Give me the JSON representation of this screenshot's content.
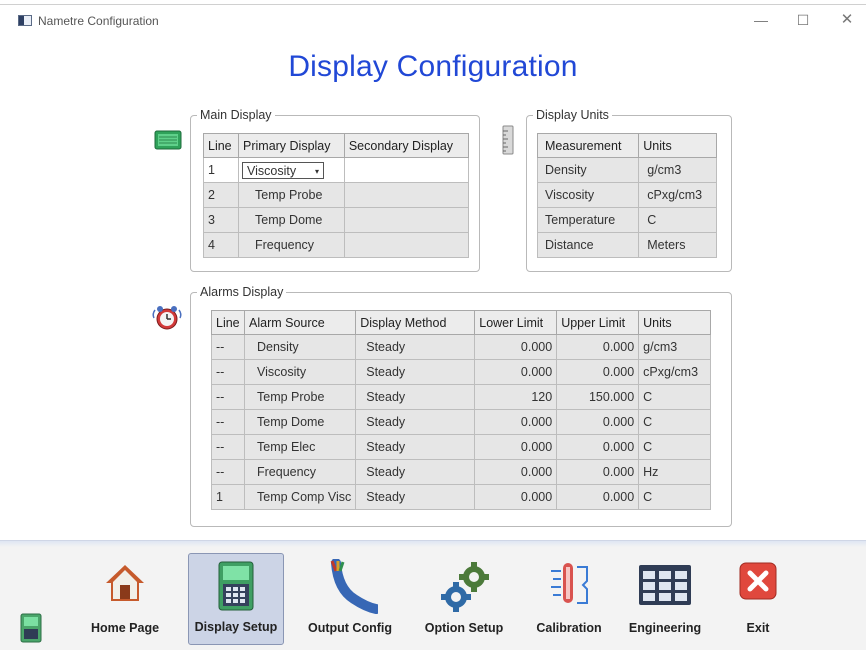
{
  "window": {
    "title": "Nametre Configuration",
    "minimize": "—",
    "maximize": "☐",
    "close": "✕"
  },
  "page_title": "Display Configuration",
  "main_display": {
    "label": "Main Display",
    "headers": [
      "Line",
      "Primary Display",
      "Secondary Display"
    ],
    "rows": [
      {
        "line": "1",
        "primary": "Viscosity",
        "secondary": ""
      },
      {
        "line": "2",
        "primary": "Temp Probe",
        "secondary": ""
      },
      {
        "line": "3",
        "primary": "Temp Dome",
        "secondary": ""
      },
      {
        "line": "4",
        "primary": "Frequency",
        "secondary": ""
      }
    ]
  },
  "display_units": {
    "label": "Display Units",
    "headers": [
      "Measurement",
      "Units"
    ],
    "rows": [
      {
        "measurement": "Density",
        "units": "g/cm3"
      },
      {
        "measurement": "Viscosity",
        "units": "cPxg/cm3"
      },
      {
        "measurement": "Temperature",
        "units": "C"
      },
      {
        "measurement": "Distance",
        "units": "Meters"
      }
    ]
  },
  "alarms_display": {
    "label": "Alarms Display",
    "headers": [
      "Line",
      "Alarm Source",
      "Display Method",
      "Lower Limit",
      "Upper Limit",
      "Units"
    ],
    "rows": [
      {
        "line": "--",
        "source": "Density",
        "method": "Steady",
        "lower": "0.000",
        "upper": "0.000",
        "units": "g/cm3"
      },
      {
        "line": "--",
        "source": "Viscosity",
        "method": "Steady",
        "lower": "0.000",
        "upper": "0.000",
        "units": "cPxg/cm3"
      },
      {
        "line": "--",
        "source": "Temp Probe",
        "method": "Steady",
        "lower": "120",
        "upper": "150.000",
        "units": "C"
      },
      {
        "line": "--",
        "source": "Temp Dome",
        "method": "Steady",
        "lower": "0.000",
        "upper": "0.000",
        "units": "C"
      },
      {
        "line": "--",
        "source": "Temp Elec",
        "method": "Steady",
        "lower": "0.000",
        "upper": "0.000",
        "units": "C"
      },
      {
        "line": "--",
        "source": "Frequency",
        "method": "Steady",
        "lower": "0.000",
        "upper": "0.000",
        "units": "Hz"
      },
      {
        "line": "1",
        "source": "Temp Comp Visc",
        "method": "Steady",
        "lower": "0.000",
        "upper": "0.000",
        "units": "C"
      }
    ]
  },
  "toolbar": {
    "home": "Home Page",
    "display": "Display Setup",
    "output": "Output Config",
    "option": "Option Setup",
    "calibration": "Calibration",
    "engineering": "Engineering",
    "exit": "Exit"
  },
  "colors": {
    "title_blue": "#2148d6",
    "active_button": "#ccd4e6",
    "exit_red": "#e0483d"
  }
}
